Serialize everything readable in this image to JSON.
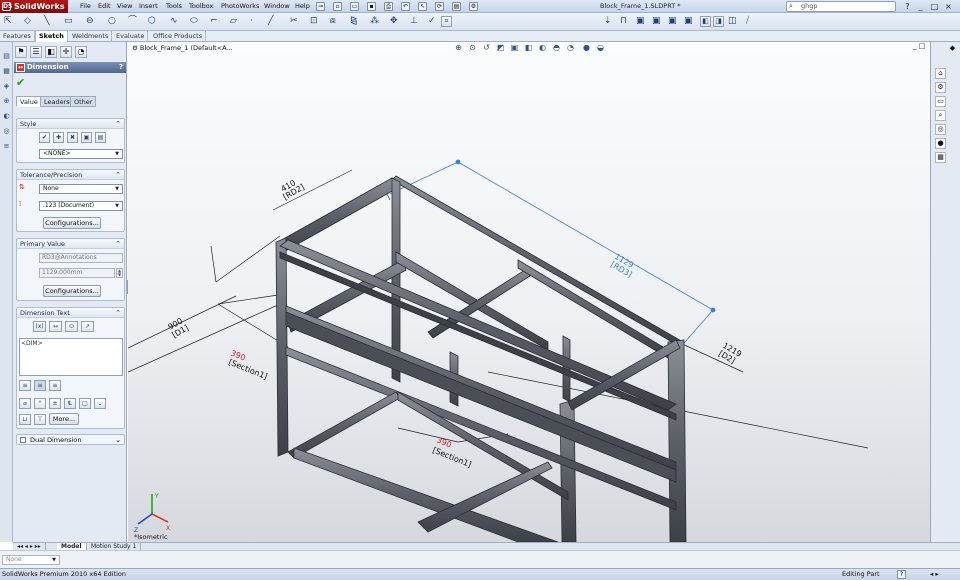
{
  "app": {
    "logo": "SolidWorks",
    "ds": "DS"
  },
  "menu": [
    "File",
    "Edit",
    "View",
    "Insert",
    "Tools",
    "Toolbox",
    "PhotoWorks",
    "Window",
    "Help"
  ],
  "doc_title": "Block_Frame_1.SLDPRT *",
  "search": {
    "value": "ghgp"
  },
  "window_controls": [
    "?",
    "_",
    "□",
    "×"
  ],
  "cm_tabs": [
    "Features",
    "Sketch",
    "Weldments",
    "Evaluate",
    "Office Products"
  ],
  "cm_active": "Sketch",
  "pm": {
    "title": "Dimension",
    "help": "?",
    "tabs": [
      "Value",
      "Leaders",
      "Other"
    ],
    "style": {
      "title": "Style",
      "select": "<NONE>"
    },
    "tolerance": {
      "title": "Tolerance/Precision",
      "tol_type": "None",
      "precision": ".123 (Document)",
      "config_btn": "Configurations..."
    },
    "primary": {
      "title": "Primary Value",
      "name": "RD3@Annotations",
      "value": "1129.000mm",
      "config_btn": "Configurations..."
    },
    "dimtext": {
      "title": "Dimension Text",
      "text": "<DIM>",
      "more_btn": "More..."
    },
    "dual": {
      "title": "Dual Dimension"
    }
  },
  "viewport": {
    "tree_label": "Block_Frame_1  (Default<A...",
    "orientation": "*Isometric",
    "dims": {
      "top_value": "410",
      "top_name": "[RD2]",
      "left_value": "900",
      "left_name": "[D1]",
      "selected_value": "1129",
      "selected_name": "[RD3]",
      "right_value": "1219",
      "right_name": "[D2]",
      "sec1_value": "390",
      "sec1_name": "[Section1]",
      "sec2_value": "390",
      "sec2_name": "[Section1]"
    },
    "axes": {
      "x": "X",
      "y": "Y",
      "z": "Z"
    }
  },
  "bottom_tabs": [
    "Model",
    "Motion Study 1"
  ],
  "bottom_active": "Model",
  "command_field": "None",
  "status": {
    "left": "SolidWorks Premium 2010 x64 Edition",
    "right": "Editing Part",
    "help": "?"
  },
  "colors": {
    "accent": "#52678f",
    "logo": "#b71515",
    "selection": "#3b82d6",
    "frame": "#5a5e65"
  }
}
